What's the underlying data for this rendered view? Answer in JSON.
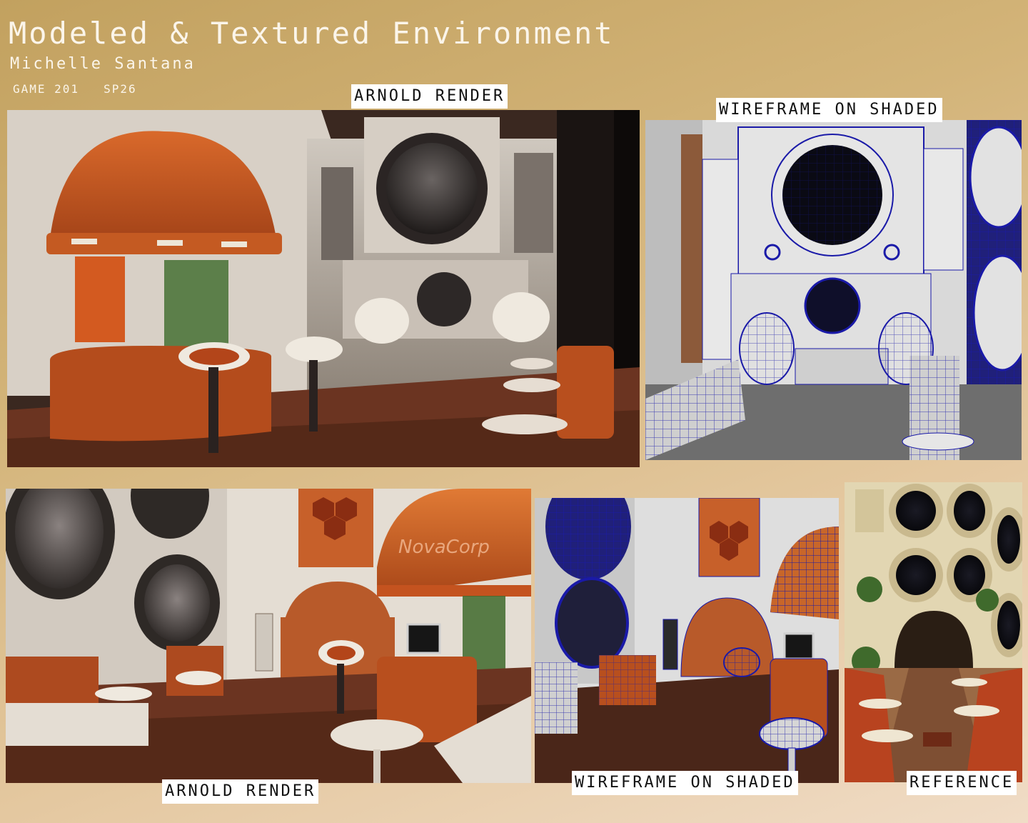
{
  "title": "Modeled & Textured Environment",
  "author": "Michelle Santana",
  "course": {
    "code": "GAME 201",
    "term": "SP26"
  },
  "labels": {
    "arnold_render_top": "ARNOLD RENDER",
    "wireframe_top": "WIREFRAME ON SHADED",
    "arnold_render_bottom": "ARNOLD RENDER",
    "wireframe_bottom": "WIREFRAME ON SHADED",
    "reference": "REFERENCE"
  },
  "sign_text": "NovaCorp",
  "colors": {
    "orange": "#c8561f",
    "wood": "#6b3421",
    "wall": "#e9e4dc",
    "wire": "#1a1aa8",
    "cream": "#ddd0a8"
  }
}
